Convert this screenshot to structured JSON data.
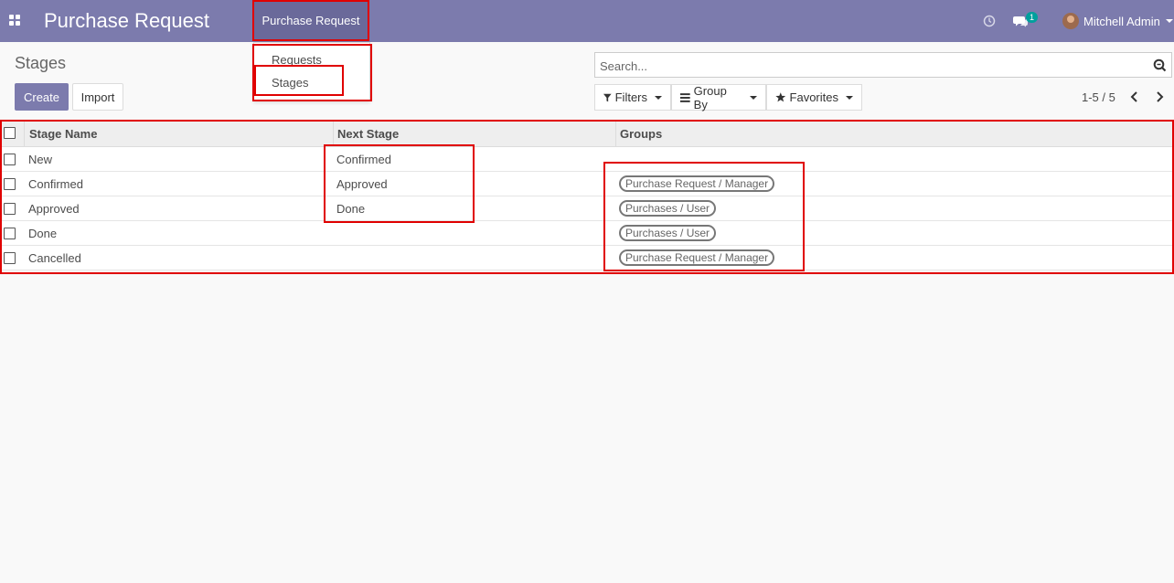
{
  "navbar": {
    "brand": "Purchase Request",
    "menu_item": "Purchase Request",
    "chat_count": "1",
    "user_name": "Mitchell Admin"
  },
  "dropdown": {
    "items": [
      "Requests",
      "Stages"
    ]
  },
  "control_panel": {
    "title": "Stages",
    "create_label": "Create",
    "import_label": "Import",
    "search_placeholder": "Search...",
    "filters_label": "Filters",
    "groupby_label": "Group By",
    "favorites_label": "Favorites",
    "pager": "1-5 / 5"
  },
  "table": {
    "headers": [
      "Stage Name",
      "Next Stage",
      "Groups"
    ],
    "rows": [
      {
        "name": "New",
        "next": "Confirmed",
        "group": ""
      },
      {
        "name": "Confirmed",
        "next": "Approved",
        "group": "Purchase Request / Manager"
      },
      {
        "name": "Approved",
        "next": "Done",
        "group": "Purchases / User"
      },
      {
        "name": "Done",
        "next": "",
        "group": "Purchases / User"
      },
      {
        "name": "Cancelled",
        "next": "",
        "group": "Purchase Request / Manager"
      }
    ]
  },
  "colors": {
    "navbar": "#7c7bad",
    "primary": "#7c7bad",
    "annotation": "#e00000",
    "badge": "#00a09d"
  }
}
